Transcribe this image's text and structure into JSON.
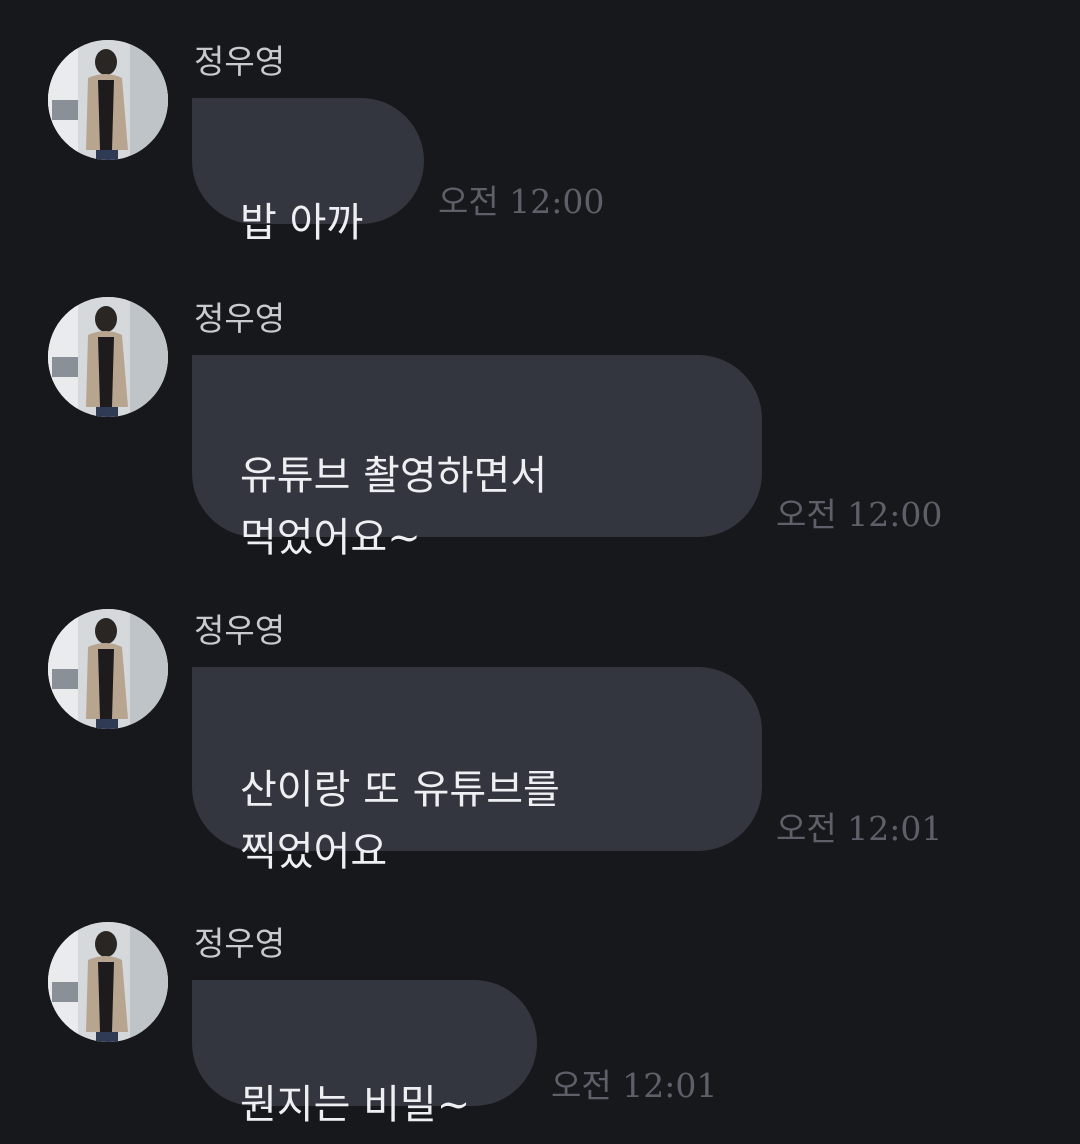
{
  "messages": [
    {
      "sender": "정우영",
      "text": "밥 아까",
      "time": "오전 12:00"
    },
    {
      "sender": "정우영",
      "text": "유튜브 촬영하면서\n먹었어요~",
      "time": "오전 12:00"
    },
    {
      "sender": "정우영",
      "text": "산이랑 또 유튜브를\n찍었어요",
      "time": "오전 12:01"
    },
    {
      "sender": "정우영",
      "text": "뭔지는 비밀~",
      "time": "오전 12:01"
    }
  ],
  "colors": {
    "background": "#17181c",
    "bubble": "#33363f",
    "sender_text": "#c9cacf",
    "message_text": "#eeeff2",
    "time_text": "#5d6068"
  },
  "icons": {
    "avatar": "profile-photo-avatar"
  }
}
